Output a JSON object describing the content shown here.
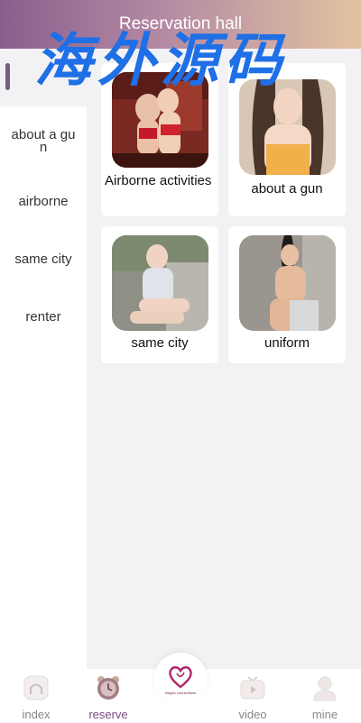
{
  "header": {
    "title": "Reservation hall"
  },
  "watermark": {
    "text": "海外源码"
  },
  "sidebar": {
    "items": [
      {
        "label": "about a gun"
      },
      {
        "label": "airborne"
      },
      {
        "label": "same city"
      },
      {
        "label": "renter"
      }
    ]
  },
  "cards": [
    {
      "label": "Airborne activities"
    },
    {
      "label": "about a gun"
    },
    {
      "label": "same city"
    },
    {
      "label": "uniform"
    }
  ],
  "tabbar": {
    "tabs": [
      {
        "label": "index",
        "icon": "home-icon",
        "active": false
      },
      {
        "label": "reserve",
        "icon": "alarm-clock-icon",
        "active": true
      },
      {
        "label": "video",
        "icon": "tv-play-icon",
        "active": false
      },
      {
        "label": "mine",
        "icon": "user-icon",
        "active": false
      }
    ],
    "center_brand": "elegan connections"
  },
  "colors": {
    "accent": "#7a4a7d",
    "watermark": "#1f6fe6",
    "header_start": "#8a5e8c",
    "header_end": "#e3c2a2"
  }
}
